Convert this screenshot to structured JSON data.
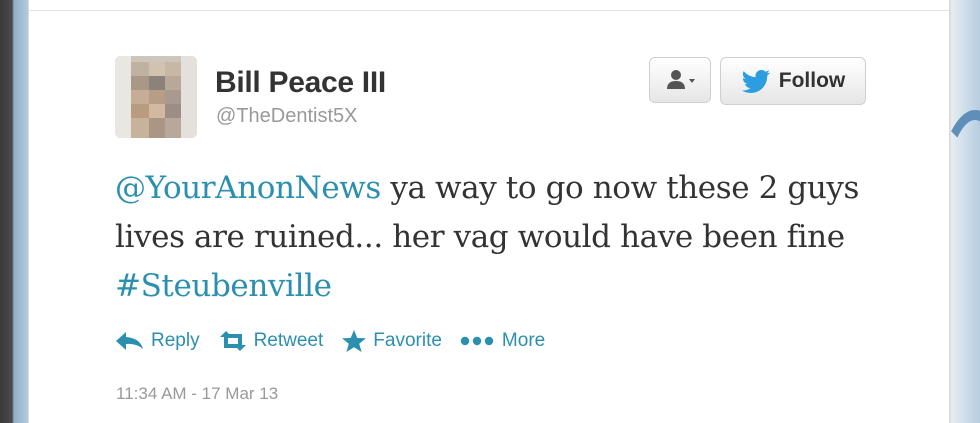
{
  "tweet": {
    "author_name": "Bill Peace III",
    "author_handle": "@TheDentist5X",
    "text_mention": "@YourAnonNews",
    "text_body": " ya way to go now these 2 guys lives are ruined... her vag would have been fine ",
    "text_hashtag": "#Steubenville",
    "timestamp": "11:34 AM - 17 Mar 13"
  },
  "buttons": {
    "follow_label": "Follow",
    "user_actions_icon": "user-dropdown-icon"
  },
  "actions": {
    "reply_label": "Reply",
    "retweet_label": "Retweet",
    "favorite_label": "Favorite",
    "more_label": "More"
  },
  "colors": {
    "link": "#2b8fb0",
    "text": "#333333",
    "muted": "#999999",
    "twitter_bird": "#2b9de0"
  }
}
